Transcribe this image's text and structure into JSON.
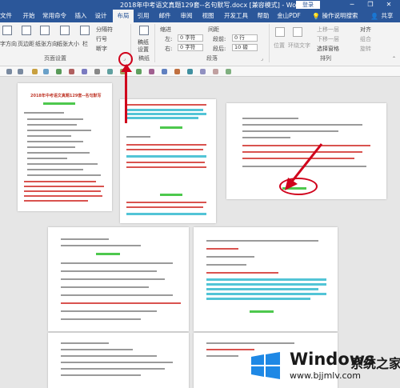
{
  "window": {
    "title": "2018年中考语文真题129套--名句默写.docx [兼容模式] - Word",
    "login": "登录",
    "min": "─",
    "restore": "❐",
    "close": "✕"
  },
  "tabs": [
    {
      "label": "文件"
    },
    {
      "label": "开始"
    },
    {
      "label": "常用命令"
    },
    {
      "label": "插入"
    },
    {
      "label": "设计"
    },
    {
      "label": "布局"
    },
    {
      "label": "引用"
    },
    {
      "label": "邮件"
    },
    {
      "label": "审阅"
    },
    {
      "label": "视图"
    },
    {
      "label": "开发工具"
    },
    {
      "label": "帮助"
    },
    {
      "label": "金山PDF"
    },
    {
      "label": "操作说明搜索"
    }
  ],
  "share": "共享",
  "ribbon": {
    "text_direction": "字方向",
    "margins": "页边距",
    "orientation": "纸张方向",
    "size": "纸张大小",
    "columns": "栏",
    "breaks": "分隔符",
    "line_numbers": "行号",
    "hyphenation": "断字",
    "page_setup_group": "页面设置",
    "manuscript_line1": "稿纸",
    "manuscript_line2": "设置",
    "manuscript_group": "稿纸",
    "indent_title": "缩进",
    "spacing_title": "间距",
    "indent_left_label": "左:",
    "indent_left_value": "0 字符",
    "indent_right_label": "右:",
    "indent_right_value": "0 字符",
    "spacing_before_label": "段前:",
    "spacing_before_value": "0 行",
    "spacing_after_label": "段后:",
    "spacing_after_value": "10 磅",
    "paragraph_group": "段落",
    "position": "位置",
    "wrap_text": "环绕文字",
    "bring_forward": "上移一层",
    "send_backward": "下移一层",
    "selection_pane": "选择窗格",
    "align": "对齐",
    "group": "组合",
    "rotate": "旋转",
    "arrange_group": "排列"
  },
  "document": {
    "page1_title": "2018年中考语文真题129套--名句默写"
  },
  "watermark": {
    "brand": "Windows",
    "brand_cn": "系统之家",
    "url": "www.bjjmlv.com"
  },
  "colors": {
    "word_blue": "#2b579a",
    "annotation_red": "#d0021b",
    "highlight_teal": "#52c4d6",
    "highlight_green": "#4dc84d"
  }
}
